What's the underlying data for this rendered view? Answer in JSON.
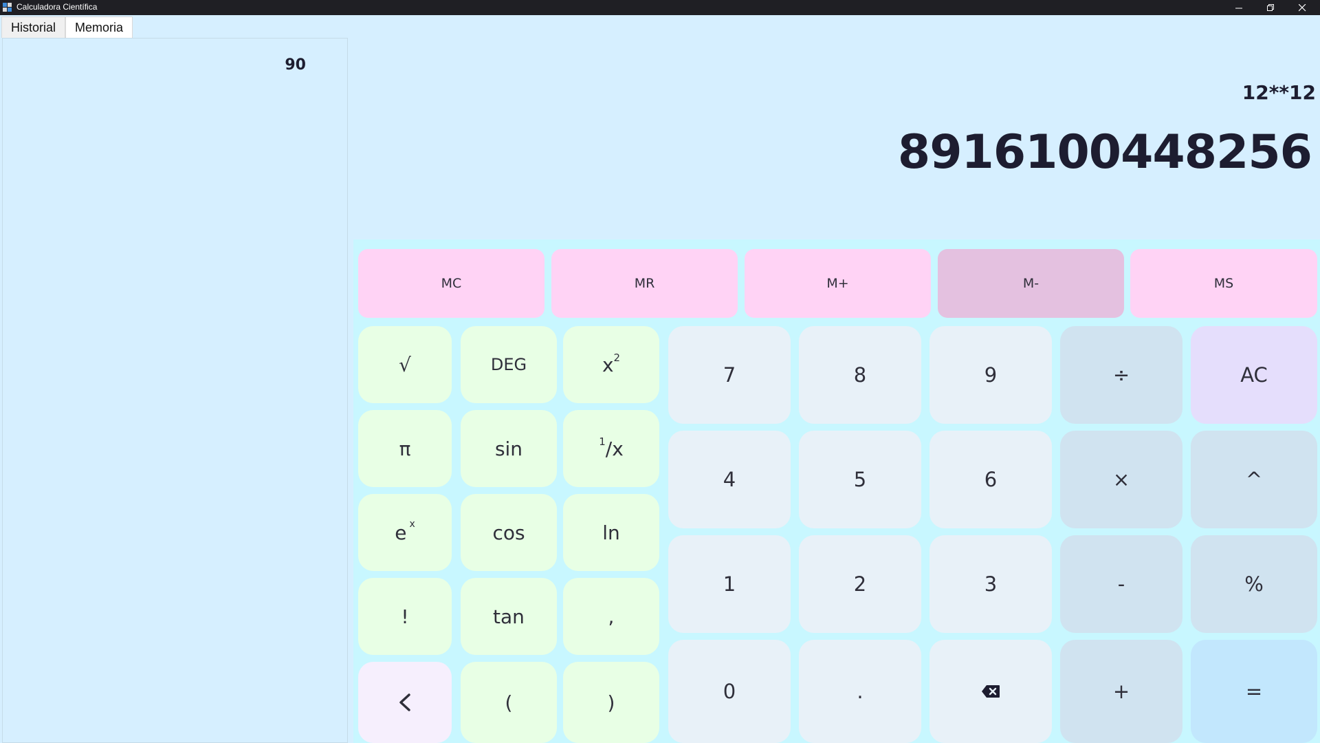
{
  "window": {
    "title": "Calculadora Científica",
    "icon_colors": [
      "#3d8bd9",
      "#d9d9d9",
      "#d9d9d9",
      "#3d8bd9"
    ]
  },
  "tabs": [
    {
      "label": "Historial",
      "active": false
    },
    {
      "label": "Memoria",
      "active": true
    }
  ],
  "memory": {
    "items": [
      "90"
    ]
  },
  "display": {
    "expression": "12**12",
    "result": "8916100448256"
  },
  "memory_keys": [
    "MC",
    "MR",
    "M+",
    "M-",
    "MS"
  ],
  "sci_keys": {
    "sqrt": "√",
    "deg": "DEG",
    "square_base": "x",
    "square_exp": "2",
    "pi": "π",
    "sin": "sin",
    "reciprocal_num": "1",
    "reciprocal_rest": "/x",
    "exp_base": "e",
    "exp_exp": "x",
    "cos": "cos",
    "ln": "ln",
    "factorial": "!",
    "tan": "tan",
    "comma": ",",
    "back": "<",
    "lparen": "(",
    "rparen": ")"
  },
  "num_keys": {
    "n7": "7",
    "n8": "8",
    "n9": "9",
    "n4": "4",
    "n5": "5",
    "n6": "6",
    "n1": "1",
    "n2": "2",
    "n3": "3",
    "n0": "0",
    "dot": "."
  },
  "op_keys": {
    "divide": "÷",
    "ac": "AC",
    "multiply": "×",
    "power": "^",
    "minus": "-",
    "percent": "%",
    "plus": "+",
    "equals": "="
  },
  "colors": {
    "background": "#d6efff",
    "keypad_bg": "#c8f7ff",
    "memory_key": "#ffd3f5",
    "memory_key_hover": "#e4c1e0",
    "sci_key": "#e8ffe5",
    "num_key": "#e8f1f8",
    "op_key": "#d0e3f0",
    "ac_key": "#e5defc",
    "equals_key": "#c2e7fd"
  }
}
